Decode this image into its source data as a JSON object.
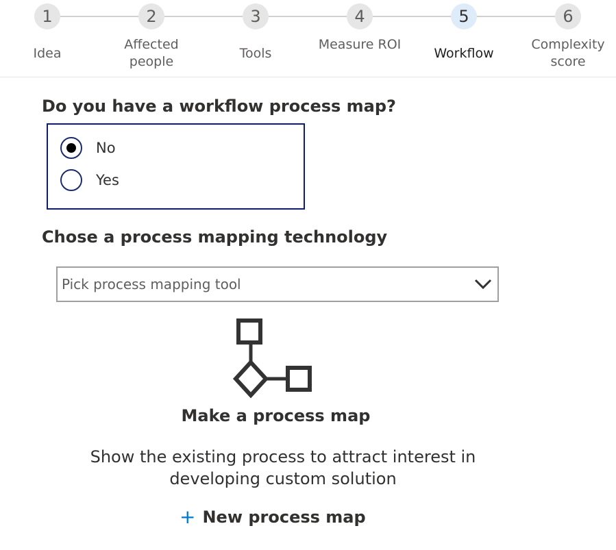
{
  "stepper": {
    "steps": [
      {
        "number": "1",
        "label": "Idea"
      },
      {
        "number": "2",
        "label": "Affected people"
      },
      {
        "number": "3",
        "label": "Tools"
      },
      {
        "number": "4",
        "label": "Measure ROI"
      },
      {
        "number": "5",
        "label": "Workflow"
      },
      {
        "number": "6",
        "label": "Complexity score"
      }
    ],
    "active_step": "5"
  },
  "question_workflow": {
    "title": "Do you have a workflow process map?",
    "options": [
      "No",
      "Yes"
    ],
    "selected": "No"
  },
  "question_technology": {
    "title": "Chose a process mapping technology",
    "dropdown_placeholder": "Pick process mapping tool"
  },
  "cta": {
    "title": "Make a process map",
    "description": "Show the existing process to attract interest in developing custom solution",
    "button_label": "New process map",
    "button_icon": "plus-icon"
  },
  "colors": {
    "accent": "#0078d4",
    "active_step_bg": "#deecf9",
    "radio_group_border": "#0f1c6b"
  }
}
